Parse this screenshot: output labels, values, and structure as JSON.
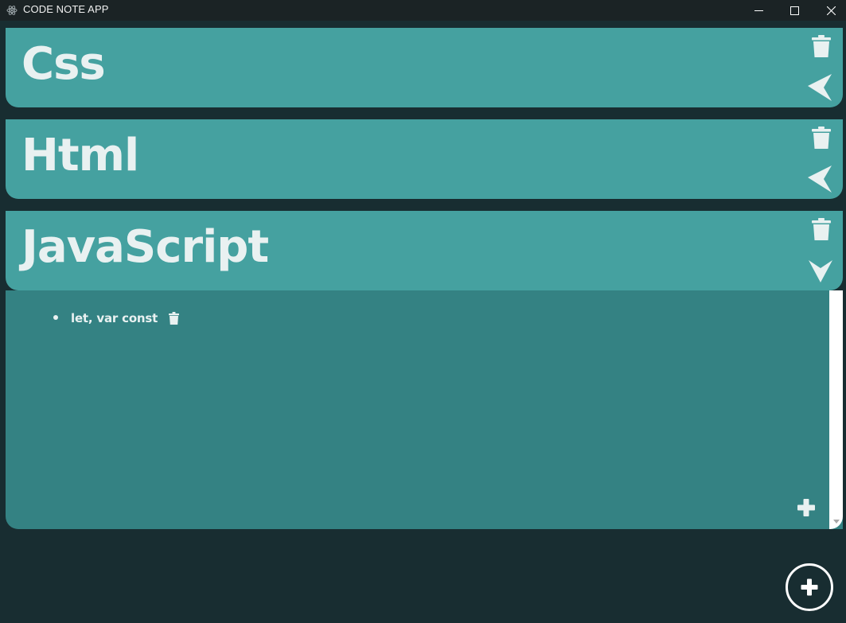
{
  "window": {
    "title": "CODE NOTE APP",
    "app_icon": "atom-icon",
    "controls": [
      "minimize-icon",
      "maximize-icon",
      "close-icon"
    ]
  },
  "colors": {
    "background": "#182d31",
    "titlebar": "#1b2325",
    "card_header": "#45a1a0",
    "card_body": "#348283",
    "text": "#e9f1f1"
  },
  "categories": [
    {
      "title": "Css",
      "expanded": false,
      "icons": [
        "trash-icon",
        "arrow-left-icon"
      ]
    },
    {
      "title": "Html",
      "expanded": false,
      "icons": [
        "trash-icon",
        "arrow-left-icon"
      ]
    },
    {
      "title": "JavaScript",
      "expanded": true,
      "icons": [
        "trash-icon",
        "arrow-down-icon"
      ],
      "notes": [
        {
          "text": "let, var const",
          "icon": "trash-icon"
        }
      ],
      "add_icon": "plus-icon"
    }
  ],
  "fab_icon": "plus-circle-icon"
}
